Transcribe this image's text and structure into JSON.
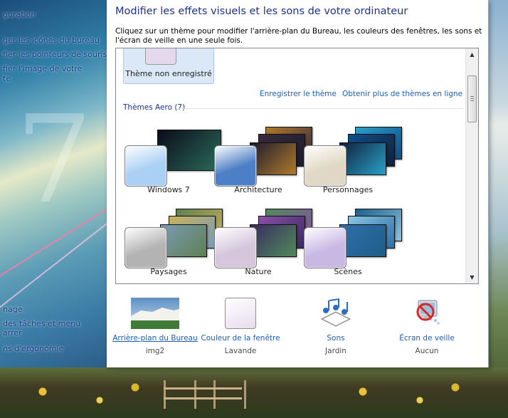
{
  "left_nav": {
    "links": [
      {
        "label": "guration"
      },
      {
        "label": "ger les icônes du bureau"
      },
      {
        "label": "fier les pointeurs de souris"
      },
      {
        "label": "fier l'image de votre"
      },
      {
        "label": "te"
      }
    ],
    "see_also": [
      {
        "label": "nage"
      },
      {
        "label": "des tâches et menu"
      },
      {
        "label": "arrer"
      },
      {
        "label": "ns d'ergonomie"
      }
    ]
  },
  "header": {
    "title": "Modifier les effets visuels et les sons de votre ordinateur",
    "description": "Cliquez sur un thème pour modifier l'arrière-plan du Bureau, les couleurs des fenêtres, les sons et l'écran de veille en une seule fois."
  },
  "themes_panel": {
    "unsaved_theme": "Thème non enregistré",
    "save_theme_link": "Enregistrer le thème",
    "more_themes_link": "Obtenir plus de thèmes en ligne",
    "group_header": "Thèmes Aero (7)",
    "themes": [
      {
        "name": "Windows 7",
        "accent": "#aad0f4",
        "card1": "#0b0b1a",
        "card2": "#1f3a2a",
        "card3": "#2b6b5a"
      },
      {
        "name": "Architecture",
        "accent": "#4d7fc6",
        "card1": "#1b1b2e",
        "card2": "#3a2b3a",
        "card3": "#b07a2a"
      },
      {
        "name": "Personnages",
        "accent": "#e0d8c4",
        "card1": "#10203a",
        "card2": "#0f4e8a",
        "card3": "#2aa0c8"
      },
      {
        "name": "Paysages",
        "accent": "#b3b3b3",
        "card1": "#7a9bb5",
        "card2": "#c9b25a",
        "card3": "#5f7f52"
      },
      {
        "name": "Nature",
        "accent": "#d5c6dc",
        "card1": "#3a2a60",
        "card2": "#8a4fa8",
        "card3": "#4f8a5a"
      },
      {
        "name": "Scènes",
        "accent": "#c9b8e4",
        "card1": "#2f6fa8",
        "card2": "#8ac4e0",
        "card3": "#1e5e8a"
      }
    ]
  },
  "settings": {
    "background": {
      "label": "Arrière-plan du Bureau",
      "value": "img2"
    },
    "window_color": {
      "label": "Couleur de la fenêtre",
      "value": "Lavande",
      "color": "#e6dcee"
    },
    "sounds": {
      "label": "Sons",
      "value": "Jardin",
      "icon": "music-notes-icon"
    },
    "screensaver": {
      "label": "Écran de veille",
      "value": "Aucun",
      "icon": "no-screensaver-icon"
    }
  }
}
